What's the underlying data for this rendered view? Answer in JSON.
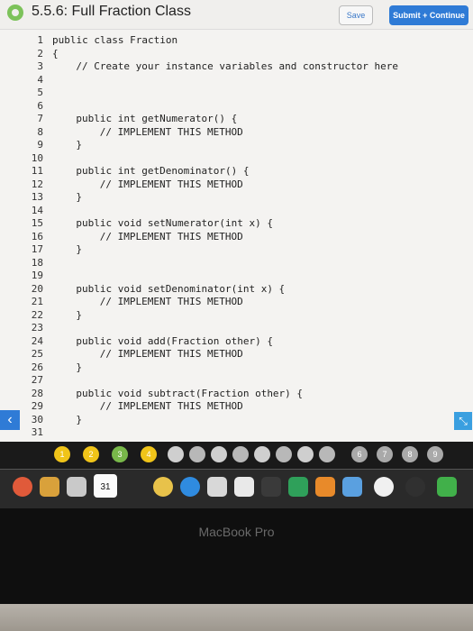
{
  "header": {
    "title": "5.5.6: Full Fraction Class",
    "save_label": "Save",
    "submit_label": "Submit + Continue"
  },
  "editor": {
    "lines": [
      {
        "n": "1",
        "text": "public class Fraction",
        "indent": 0
      },
      {
        "n": "2",
        "text": "{",
        "indent": 0
      },
      {
        "n": "3",
        "text": "// Create your instance variables and constructor here",
        "indent": 4
      },
      {
        "n": "4",
        "text": "",
        "indent": 0
      },
      {
        "n": "5",
        "text": "",
        "indent": 0
      },
      {
        "n": "6",
        "text": "",
        "indent": 0
      },
      {
        "n": "7",
        "text": "public int getNumerator() {",
        "indent": 4
      },
      {
        "n": "8",
        "text": "// IMPLEMENT THIS METHOD",
        "indent": 8
      },
      {
        "n": "9",
        "text": "}",
        "indent": 4
      },
      {
        "n": "10",
        "text": "",
        "indent": 0
      },
      {
        "n": "11",
        "text": "public int getDenominator() {",
        "indent": 4
      },
      {
        "n": "12",
        "text": "// IMPLEMENT THIS METHOD",
        "indent": 8
      },
      {
        "n": "13",
        "text": "}",
        "indent": 4
      },
      {
        "n": "14",
        "text": "",
        "indent": 0
      },
      {
        "n": "15",
        "text": "public void setNumerator(int x) {",
        "indent": 4
      },
      {
        "n": "16",
        "text": "// IMPLEMENT THIS METHOD",
        "indent": 8
      },
      {
        "n": "17",
        "text": "}",
        "indent": 4
      },
      {
        "n": "18",
        "text": "",
        "indent": 0
      },
      {
        "n": "19",
        "text": "",
        "indent": 0
      },
      {
        "n": "20",
        "text": "public void setDenominator(int x) {",
        "indent": 4
      },
      {
        "n": "21",
        "text": "// IMPLEMENT THIS METHOD",
        "indent": 8
      },
      {
        "n": "22",
        "text": "}",
        "indent": 4
      },
      {
        "n": "23",
        "text": "",
        "indent": 0
      },
      {
        "n": "24",
        "text": "public void add(Fraction other) {",
        "indent": 4
      },
      {
        "n": "25",
        "text": "// IMPLEMENT THIS METHOD",
        "indent": 8
      },
      {
        "n": "26",
        "text": "}",
        "indent": 4
      },
      {
        "n": "27",
        "text": "",
        "indent": 0
      },
      {
        "n": "28",
        "text": "public void subtract(Fraction other) {",
        "indent": 4
      },
      {
        "n": "29",
        "text": "// IMPLEMENT THIS METHOD",
        "indent": 8
      },
      {
        "n": "30",
        "text": "}",
        "indent": 4
      },
      {
        "n": "31",
        "text": "",
        "indent": 0
      }
    ]
  },
  "progress": {
    "items": [
      "1",
      "2",
      "3",
      "4",
      "6",
      "7",
      "8",
      "9"
    ]
  },
  "dock": {
    "calendar_day": "31"
  },
  "laptop": {
    "label": "MacBook Pro"
  },
  "colors": {
    "accent": "#2f7bd6",
    "dot_yellow": "#f0c419",
    "dot_green": "#78b84a",
    "dot_gray": "#a9a9a9"
  }
}
